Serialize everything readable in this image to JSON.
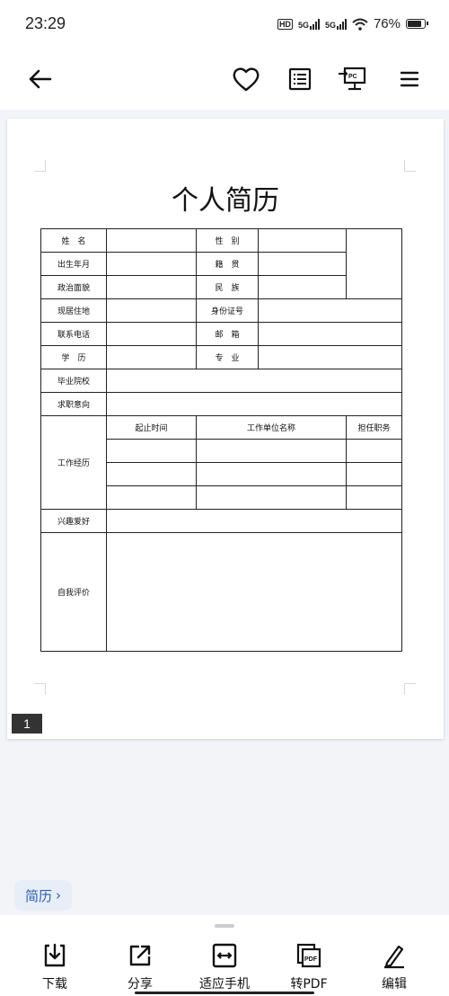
{
  "status_bar": {
    "time": "23:29",
    "hd_label": "HD",
    "net1": "5G",
    "net2": "5G",
    "battery": "76%",
    "battery_level": 0.76
  },
  "toolbar": {
    "icons": [
      "back-arrow-icon",
      "heart-icon",
      "outline-icon",
      "pc-mode-icon",
      "menu-icon"
    ]
  },
  "document": {
    "title": "个人简历",
    "fields": {
      "name": "姓　名",
      "gender": "性　别",
      "birth": "出生年月",
      "native_place": "籍　贯",
      "political": "政治面貌",
      "ethnicity": "民　族",
      "residence": "现居住地",
      "id_number": "身份证号",
      "phone": "联系电话",
      "email": "邮　箱",
      "education": "学　历",
      "major": "专　业",
      "school": "毕业院校",
      "job_intent": "求职意向",
      "work_exp": "工作经历",
      "hobbies": "兴趣爱好",
      "self_eval": "自我评价"
    },
    "work_headers": [
      "起止时间",
      "工作单位名称",
      "担任职务"
    ],
    "page_number": "1"
  },
  "chip": {
    "label": "简历",
    "arrow": "›"
  },
  "bottom_actions": [
    {
      "label": "下载",
      "icon": "download-icon"
    },
    {
      "label": "分享",
      "icon": "share-icon"
    },
    {
      "label": "适应手机",
      "icon": "fit-phone-icon"
    },
    {
      "label": "转PDF",
      "icon": "pdf-icon"
    },
    {
      "label": "编辑",
      "icon": "edit-icon"
    }
  ]
}
